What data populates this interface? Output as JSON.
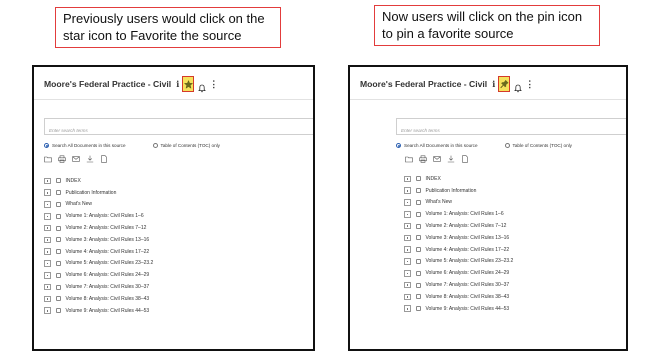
{
  "callouts": {
    "left_text": "Previously users would click on the star icon to Favorite the source",
    "right_text": "Now users will click on the pin icon to pin a favorite source"
  },
  "panel": {
    "title": "Moore's Federal Practice - Civil",
    "info_glyph": "i",
    "more_glyph": "⋮",
    "search_placeholder": "Enter search terms",
    "radio_all": "Search All Documents in this source",
    "radio_toc": "Table of Contents (TOC) only",
    "toc_items": [
      "INDEX",
      "Publication Information",
      "What's New",
      "Volume 1: Analysis: Civil Rules 1–6",
      "Volume 2: Analysis: Civil Rules 7–12",
      "Volume 3: Analysis: Civil Rules 13–16",
      "Volume 4: Analysis: Civil Rules 17–22",
      "Volume 5: Analysis: Civil Rules 23–23.2",
      "Volume 6: Analysis: Civil Rules 24–29",
      "Volume 7: Analysis: Civil Rules 30–37",
      "Volume 8: Analysis: Civil Rules 38–43",
      "Volume 9: Analysis: Civil Rules 44–53"
    ]
  },
  "icons": {
    "left_favorite": "star-icon",
    "right_favorite": "pin-icon",
    "highlight_color": "#f5e25c",
    "highlight_border": "#d43a2a"
  }
}
